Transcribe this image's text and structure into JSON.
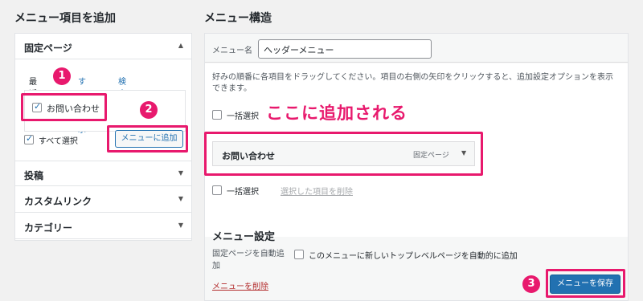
{
  "left": {
    "heading": "メニュー項目を追加",
    "pages_section": "固定ページ",
    "tabs": [
      "最近",
      "すべて表示",
      "検索"
    ],
    "item_label": "お問い合わせ",
    "select_all": "すべて選択",
    "add_button": "メニューに追加",
    "sections": [
      "投稿",
      "カスタムリンク",
      "カテゴリー"
    ]
  },
  "right": {
    "heading": "メニュー構造",
    "name_label": "メニュー名",
    "name_value": "ヘッダーメニュー",
    "instruction": "好みの順番に各項目をドラッグしてください。項目の右側の矢印をクリックすると、追加設定オプションを表示できます。",
    "bulk_select": "一括選択",
    "menu_item": {
      "title": "お問い合わせ",
      "type": "固定ページ"
    },
    "delete_selected": "選択した項目を削除",
    "settings_heading": "メニュー設定",
    "auto_add_label": "固定ページを自動追加",
    "auto_add_option": "このメニューに新しいトップレベルページを自動的に追加",
    "delete_menu": "メニューを削除",
    "save_button": "メニューを保存"
  },
  "annotations": {
    "callout": "ここに追加される",
    "steps": [
      "1",
      "2",
      "3"
    ]
  },
  "colors": {
    "accent": "#e8196d",
    "wp_blue": "#2271b1"
  }
}
